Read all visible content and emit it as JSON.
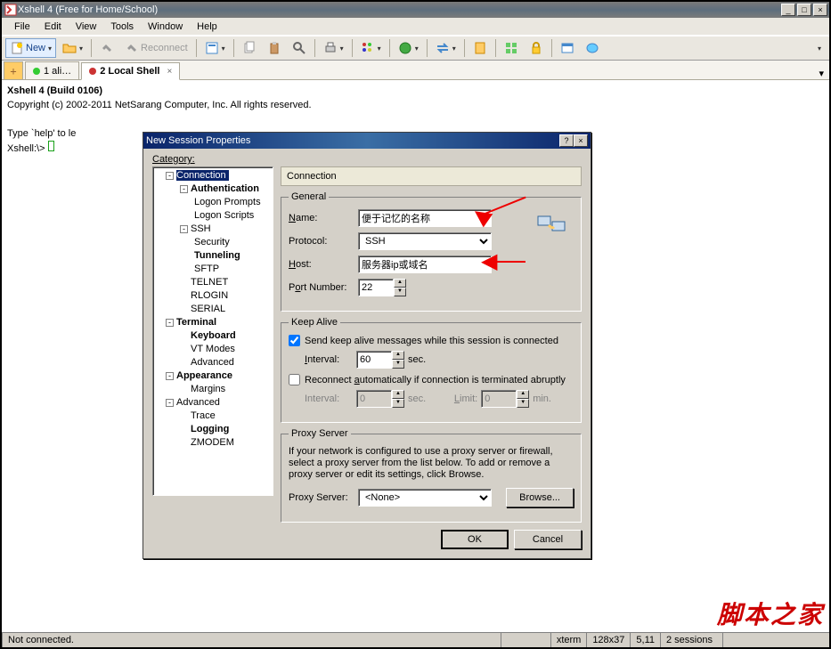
{
  "window": {
    "title": "Xshell 4 (Free for Home/School)"
  },
  "menu": {
    "file": "File",
    "edit": "Edit",
    "view": "View",
    "tools": "Tools",
    "window": "Window",
    "help": "Help"
  },
  "toolbar": {
    "new_label": "New",
    "reconnect_label": "Reconnect"
  },
  "tabs": {
    "t1": "1 ali…",
    "t2": "2 Local Shell"
  },
  "terminal": {
    "line1": "Xshell 4 (Build 0106)",
    "line2": "Copyright (c) 2002-2011 NetSarang Computer, Inc. All rights reserved.",
    "line3": "",
    "line4": "Type `help' to le",
    "prompt": "Xshell:\\> "
  },
  "dialog": {
    "title": "New Session Properties",
    "category_label": "Category:",
    "header": "Connection",
    "tree": {
      "connection": "Connection",
      "authentication": "Authentication",
      "logon_prompts": "Logon Prompts",
      "logon_scripts": "Logon Scripts",
      "ssh": "SSH",
      "security": "Security",
      "tunneling": "Tunneling",
      "sftp": "SFTP",
      "telnet": "TELNET",
      "rlogin": "RLOGIN",
      "serial": "SERIAL",
      "terminal": "Terminal",
      "keyboard": "Keyboard",
      "vt_modes": "VT Modes",
      "advanced": "Advanced",
      "appearance": "Appearance",
      "margins": "Margins",
      "advanced2": "Advanced",
      "trace": "Trace",
      "logging": "Logging",
      "zmodem": "ZMODEM"
    },
    "general": {
      "legend": "General",
      "name_label": "Name:",
      "name_value": "便于记忆的名称",
      "protocol_label": "Protocol:",
      "protocol_value": "SSH",
      "host_label": "Host:",
      "host_value": "服务器ip或域名",
      "port_label": "Port Number:",
      "port_value": "22"
    },
    "keepalive": {
      "legend": "Keep Alive",
      "chk1": "Send keep alive messages while this session is connected",
      "interval_label": "Interval:",
      "interval_value": "60",
      "sec": "sec.",
      "chk2": "Reconnect automatically if connection is terminated abruptly",
      "interval2_value": "0",
      "limit_label": "Limit:",
      "limit_value": "0",
      "min": "min."
    },
    "proxy": {
      "legend": "Proxy Server",
      "desc": "If your network is configured to use a proxy server or firewall, select a proxy server from the list below. To add or remove a proxy server or edit its settings, click Browse.",
      "label": "Proxy Server:",
      "value": "<None>",
      "browse": "Browse..."
    },
    "ok": "OK",
    "cancel": "Cancel"
  },
  "status": {
    "connection": "Not connected.",
    "term": "xterm",
    "size": "128x37",
    "pos": "5,11",
    "sessions": "2 sessions"
  },
  "watermark": "脚本之家",
  "colors": {
    "accent": "#0a246a"
  }
}
